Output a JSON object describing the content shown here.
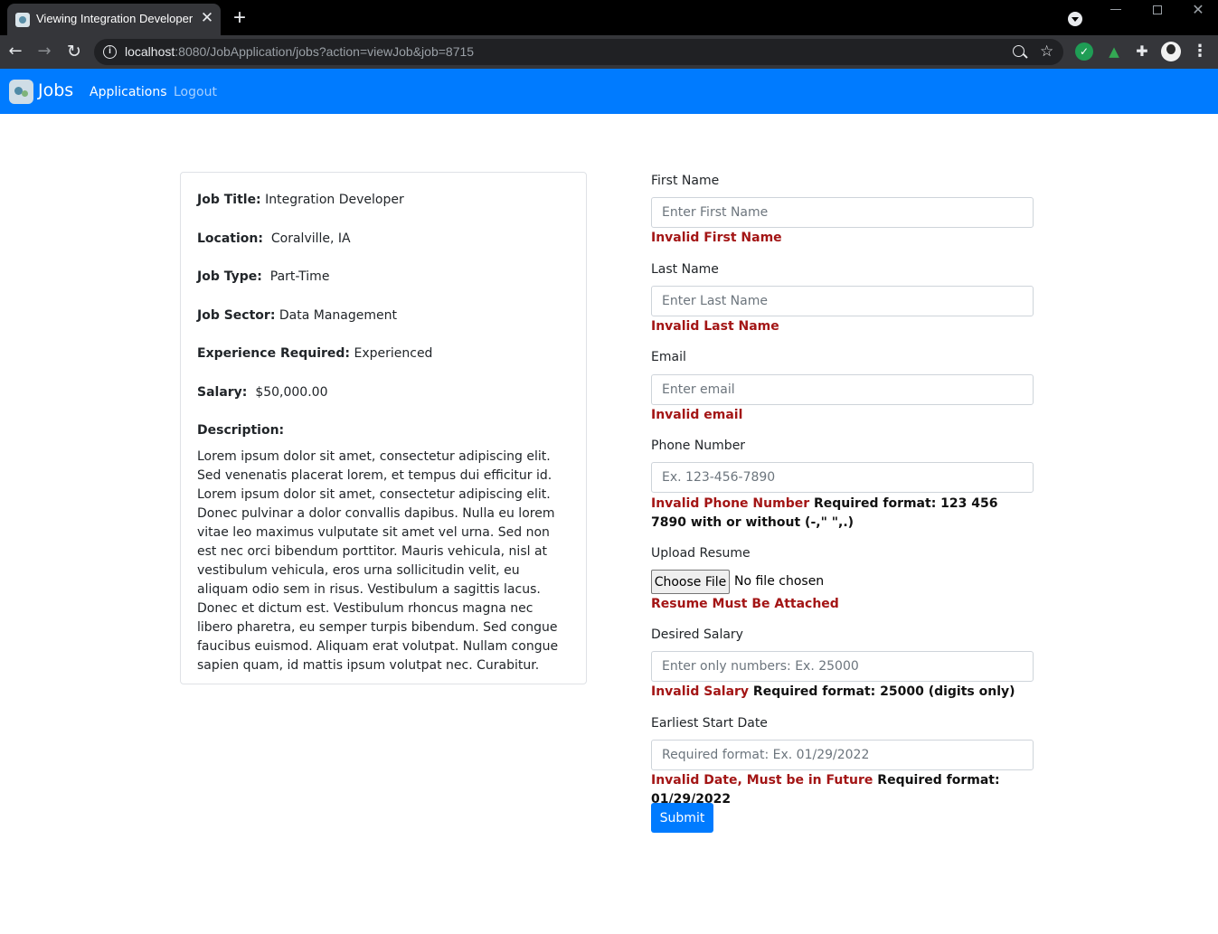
{
  "browser": {
    "tab_title": "Viewing Integration Developer",
    "url_host": "localhost",
    "url_rest": ":8080/JobApplication/jobs?action=viewJob&job=8715"
  },
  "nav": {
    "brand": "Jobs",
    "links": [
      "Applications",
      "Logout"
    ]
  },
  "job": {
    "title_label": "Job Title:",
    "title": "Integration Developer",
    "location_label": "Location:",
    "location": "Coralville,  IA",
    "type_label": "Job Type:",
    "type": "Part-Time",
    "sector_label": "Job Sector:",
    "sector": "Data Management",
    "experience_label": "Experience Required:",
    "experience": "Experienced",
    "salary_label": "Salary:",
    "salary": "$50,000.00",
    "description_label": "Description:",
    "description": "Lorem ipsum dolor sit amet, consectetur adipiscing elit. Sed venenatis placerat lorem, et tempus dui efficitur id. Lorem ipsum dolor sit amet, consectetur adipiscing elit. Donec pulvinar a dolor convallis dapibus. Nulla eu lorem vitae leo maximus vulputate sit amet vel urna. Sed non est nec orci bibendum porttitor. Mauris vehicula, nisl at vestibulum vehicula, eros urna sollicitudin velit, eu aliquam odio sem in risus. Vestibulum a sagittis lacus. Donec et dictum est. Vestibulum rhoncus magna nec libero pharetra, eu semper turpis bibendum. Sed congue faucibus euismod. Aliquam erat volutpat. Nullam congue sapien quam, id mattis ipsum volutpat nec. Curabitur."
  },
  "form": {
    "first_name": {
      "label": "First Name",
      "placeholder": "Enter First Name",
      "value": "",
      "error": "Invalid First Name"
    },
    "last_name": {
      "label": "Last Name",
      "placeholder": "Enter Last Name",
      "value": "",
      "error": "Invalid Last Name"
    },
    "email": {
      "label": "Email",
      "placeholder": "Enter email",
      "value": "",
      "error": "Invalid email"
    },
    "phone": {
      "label": "Phone Number",
      "placeholder": "Ex. 123-456-7890",
      "value": "",
      "error": "Invalid Phone Number",
      "hint": " Required format: 123 456 7890 with or without (-,\" \",.)"
    },
    "resume": {
      "label": "Upload Resume",
      "button": "Choose File",
      "status": "No file chosen",
      "error": "Resume Must Be Attached"
    },
    "salary": {
      "label": "Desired Salary",
      "placeholder": "Enter only numbers: Ex. 25000",
      "value": "",
      "error": "Invalid Salary",
      "hint": " Required format: 25000 (digits only)"
    },
    "start_date": {
      "label": "Earliest Start Date",
      "placeholder": "Required format: Ex. 01/29/2022",
      "value": "",
      "error": "Invalid Date, Must be in Future",
      "hint": " Required format: 01/29/2022"
    },
    "submit": "Submit"
  },
  "colors": {
    "navbar": "#007bff",
    "error": "#a31515",
    "primary_button": "#007bff"
  }
}
